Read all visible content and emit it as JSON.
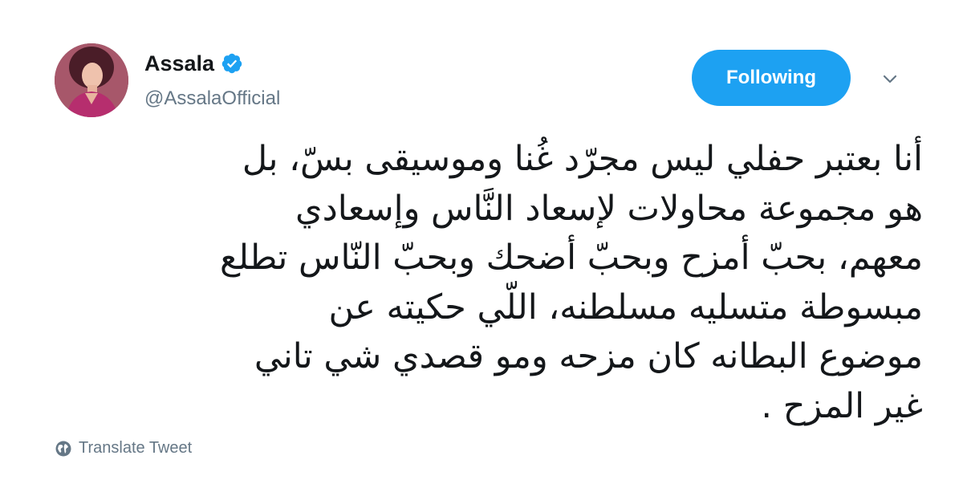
{
  "user": {
    "display_name": "Assala",
    "handle": "@AssalaOfficial",
    "verified": true
  },
  "follow_button": {
    "label": "Following"
  },
  "tweet": {
    "lines": [
      "أنا بعتبر حفلي ليس مجرّد غُنا وموسيقى بسّ، بل",
      "هو مجموعة محاولات لإسعاد النَّاس وإسعادي",
      "معهم، بحبّ أمزح وبحبّ أضحك وبحبّ النّاس تطلع",
      "مبسوطة متسليه  مسلطنه، اللّي حكيته عن",
      "موضوع البطانه كان مزحه ومو قصدي شي تاني",
      "غير المزح ."
    ]
  },
  "translate": {
    "label": "Translate Tweet"
  },
  "colors": {
    "accent": "#1da1f2",
    "text_primary": "#14171a",
    "text_secondary": "#657786"
  },
  "icons": {
    "verified": "verified-badge-icon",
    "menu": "chevron-down-icon",
    "translate": "globe-icon"
  }
}
